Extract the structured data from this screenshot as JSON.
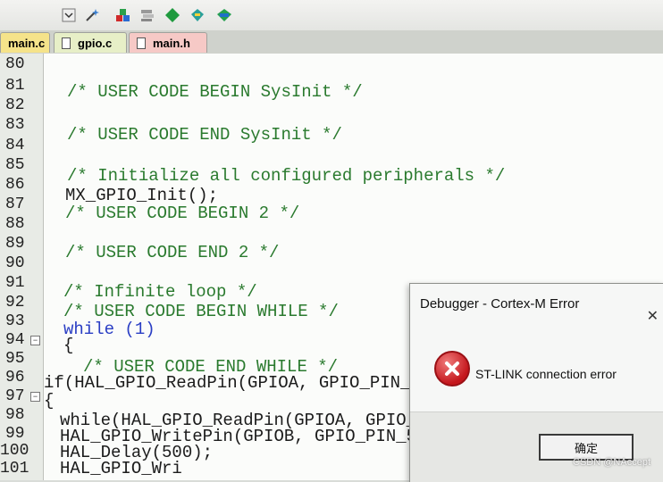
{
  "tabs": [
    {
      "label": "main.c",
      "active": true
    },
    {
      "label": "gpio.c",
      "active": false
    },
    {
      "label": "main.h",
      "active": false
    }
  ],
  "gutter": {
    "line_numbers": [
      "80",
      "81",
      "82",
      "83",
      "84",
      "85",
      "86",
      "87",
      "88",
      "89",
      "90",
      "91",
      "92",
      "93",
      "94",
      "95",
      "96",
      "97",
      "98",
      "99",
      "100",
      "101"
    ],
    "fold_markers": [
      "94",
      "97"
    ]
  },
  "code_lines": [
    {
      "text": "/* USER CODE BEGIN SysInit */",
      "kind": "comment"
    },
    {
      "text": "/* USER CODE END SysInit */",
      "kind": "comment"
    },
    {
      "text": "/* Initialize all configured peripherals */",
      "kind": "comment"
    },
    {
      "text": "MX_GPIO_Init();",
      "kind": "code"
    },
    {
      "text": "/* USER CODE BEGIN 2 */",
      "kind": "comment"
    },
    {
      "text": "/* USER CODE END 2 */",
      "kind": "comment"
    },
    {
      "text": "/* Infinite loop */",
      "kind": "comment"
    },
    {
      "text": "/* USER CODE BEGIN WHILE */",
      "kind": "comment"
    },
    {
      "text": "while (1)",
      "kind": "keyword"
    },
    {
      "text": "{",
      "kind": "code"
    },
    {
      "text": "/* USER CODE END WHILE */",
      "kind": "comment"
    },
    {
      "text": "if(HAL_GPIO_ReadPin(GPIOA, GPIO_PIN_3",
      "kind": "code"
    },
    {
      "text": "{",
      "kind": "code"
    },
    {
      "text": "while(HAL_GPIO_ReadPin(GPIOA, GPIO_",
      "kind": "code"
    },
    {
      "text": "HAL_GPIO_WritePin(GPIOB, GPIO_PIN_5, GPIO_PIN_RESET",
      "kind": "code"
    },
    {
      "text": "HAL_Delay(500);",
      "kind": "code"
    },
    {
      "text": "HAL_GPIO_Wri",
      "kind": "code"
    }
  ],
  "dialog": {
    "title": "Debugger - Cortex-M Error",
    "message": "ST-LINK connection error",
    "ok_label": "确定",
    "close_glyph": "✕"
  },
  "watermark": "CSDN @NAccept",
  "colors": {
    "comment": "#2a7a2e",
    "keyword": "#2a3ec4",
    "error_red": "#c4161c",
    "tab_active": "#f5e38a",
    "tab_gpio": "#e7efc7",
    "tab_main_h": "#f6c9c6"
  }
}
